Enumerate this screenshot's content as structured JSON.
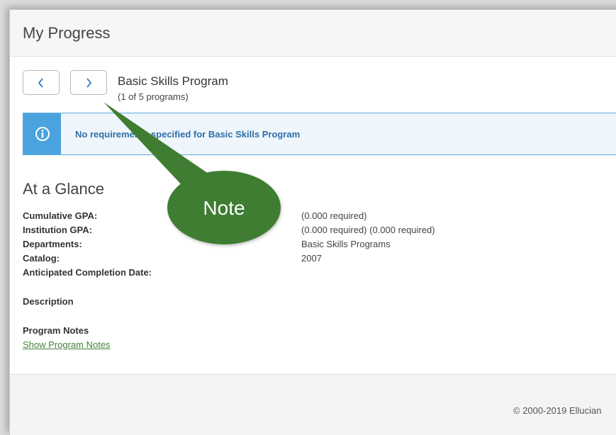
{
  "header": {
    "title": "My Progress"
  },
  "program_nav": {
    "prev_icon": "chevron-left-icon",
    "next_icon": "chevron-right-icon",
    "program_title": "Basic Skills Program",
    "program_count": "(1 of 5 programs)"
  },
  "info_banner": {
    "icon": "info-icon",
    "message": "No requirements specified for Basic Skills Program"
  },
  "at_a_glance": {
    "title": "At a Glance",
    "rows": [
      {
        "label": "Cumulative GPA:",
        "value": "(0.000 required)"
      },
      {
        "label": "Institution GPA:",
        "value": "(0.000 required) (0.000 required)"
      },
      {
        "label": "Departments:",
        "value": "Basic Skills Programs"
      },
      {
        "label": "Catalog:",
        "value": "2007"
      },
      {
        "label": "Anticipated Completion Date:",
        "value": ""
      }
    ],
    "description_label": "Description",
    "program_notes_label": "Program Notes",
    "program_notes_link": "Show Program Notes"
  },
  "footer": {
    "copyright": "© 2000-2019 Ellucian"
  },
  "callout": {
    "text": "Note",
    "color": "#3f7d32"
  },
  "colors": {
    "accent_blue": "#4aa3df",
    "link_green": "#45813a",
    "info_text": "#2f6ea8"
  }
}
